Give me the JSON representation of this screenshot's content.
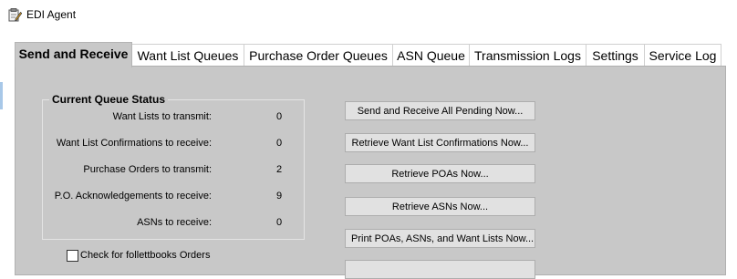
{
  "window": {
    "title": "EDI Agent",
    "icon": "clipboard-pencil-icon"
  },
  "tabs": [
    {
      "label": "Send and Receive",
      "active": true
    },
    {
      "label": "Want List Queues",
      "active": false
    },
    {
      "label": "Purchase Order Queues",
      "active": false
    },
    {
      "label": "ASN Queue",
      "active": false
    },
    {
      "label": "Transmission Logs",
      "active": false
    },
    {
      "label": "Settings",
      "active": false
    },
    {
      "label": "Service Log",
      "active": false
    }
  ],
  "queue_status": {
    "title": "Current Queue Status",
    "rows": [
      {
        "label": "Want Lists to transmit:",
        "value": "0"
      },
      {
        "label": "Want List Confirmations to receive:",
        "value": "0"
      },
      {
        "label": "Purchase Orders to transmit:",
        "value": "2"
      },
      {
        "label": "P.O. Acknowledgements to receive:",
        "value": "9"
      },
      {
        "label": "ASNs to receive:",
        "value": "0"
      }
    ]
  },
  "actions": [
    "Send and Receive All Pending Now...",
    "Retrieve Want List Confirmations Now...",
    "Retrieve POAs Now...",
    "Retrieve ASNs Now...",
    "Print POAs, ASNs, and Want Lists Now..."
  ],
  "follett_checkbox": {
    "label": "Check for follettbooks Orders",
    "checked": false
  },
  "colors": {
    "panel": "#c8c8c8",
    "button": "#e1e1e1",
    "tab_inactive": "#ffffff"
  }
}
